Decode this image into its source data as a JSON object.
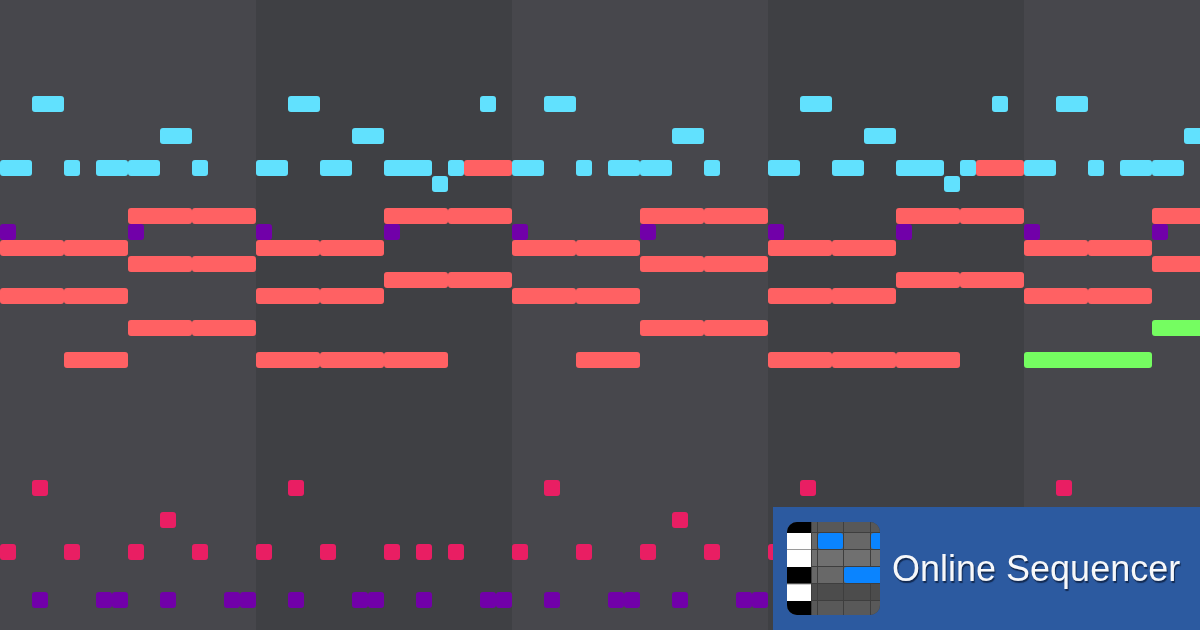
{
  "piano_roll": {
    "notes": [
      {
        "color": "#61e1fe"
      },
      {
        "color": "#61e1fe"
      },
      {
        "color": "#61e1fe"
      },
      {
        "color": "#61e1fe"
      },
      {
        "color": "#61e1fe"
      },
      {
        "color": "#61e1fe"
      },
      {
        "color": "#61e1fe"
      },
      {
        "color": "#61e1fe"
      },
      {
        "color": "#61e1fe"
      },
      {
        "color": "#61e1fe"
      },
      {
        "color": "#61e1fe"
      },
      {
        "color": "#61e1fe"
      },
      {
        "color": "#61e1fe"
      },
      {
        "color": "#61e1fe"
      },
      {
        "color": "#61e1fe"
      },
      {
        "color": "#61e1fe"
      },
      {
        "color": "#61e1fe"
      },
      {
        "color": "#61e1fe"
      },
      {
        "color": "#61e1fe"
      },
      {
        "color": "#61e1fe"
      },
      {
        "color": "#61e1fe"
      },
      {
        "color": "#ff6163"
      },
      {
        "color": "#61e1fe"
      },
      {
        "color": "#61e1fe"
      },
      {
        "color": "#61e1fe"
      },
      {
        "color": "#61e1fe"
      },
      {
        "color": "#61e1fe"
      },
      {
        "color": "#61e1fe"
      },
      {
        "color": "#61e1fe"
      },
      {
        "color": "#61e1fe"
      },
      {
        "color": "#61e1fe"
      },
      {
        "color": "#ff6163"
      },
      {
        "color": "#61e1fe"
      },
      {
        "color": "#61e1fe"
      },
      {
        "color": "#61e1fe"
      },
      {
        "color": "#61e1fe"
      },
      {
        "color": "#61e1fe"
      },
      {
        "color": "#61e1fe"
      },
      {
        "color": "#ff6163"
      },
      {
        "color": "#ff6163"
      },
      {
        "color": "#ff6163"
      },
      {
        "color": "#ff6163"
      },
      {
        "color": "#ff6163"
      },
      {
        "color": "#ff6163"
      },
      {
        "color": "#ff6163"
      },
      {
        "color": "#ff6163"
      },
      {
        "color": "#ff6163"
      },
      {
        "color": "#7100a9"
      },
      {
        "color": "#7100a9"
      },
      {
        "color": "#7100a9"
      },
      {
        "color": "#7100a9"
      },
      {
        "color": "#7100a9"
      },
      {
        "color": "#7100a9"
      },
      {
        "color": "#7100a9"
      },
      {
        "color": "#7100a9"
      },
      {
        "color": "#7100a9"
      },
      {
        "color": "#7100a9"
      },
      {
        "color": "#ff6163"
      },
      {
        "color": "#ff6163"
      },
      {
        "color": "#ff6163"
      },
      {
        "color": "#ff6163"
      },
      {
        "color": "#ff6163"
      },
      {
        "color": "#ff6163"
      },
      {
        "color": "#ff6163"
      },
      {
        "color": "#ff6163"
      },
      {
        "color": "#ff6163"
      },
      {
        "color": "#ff6163"
      },
      {
        "color": "#ff6163"
      },
      {
        "color": "#ff6163"
      },
      {
        "color": "#ff6163"
      },
      {
        "color": "#ff6163"
      },
      {
        "color": "#ff6163"
      },
      {
        "color": "#ff6163"
      },
      {
        "color": "#ff6163"
      },
      {
        "color": "#ff6163"
      },
      {
        "color": "#ff6163"
      },
      {
        "color": "#ff6163"
      },
      {
        "color": "#ff6163"
      },
      {
        "color": "#ff6163"
      },
      {
        "color": "#ff6163"
      },
      {
        "color": "#ff6163"
      },
      {
        "color": "#ff6163"
      },
      {
        "color": "#ff6163"
      },
      {
        "color": "#ff6163"
      },
      {
        "color": "#ff6163"
      },
      {
        "color": "#ff6163"
      },
      {
        "color": "#ff6163"
      },
      {
        "color": "#ff6163"
      },
      {
        "color": "#ff6163"
      },
      {
        "color": "#ff6163"
      },
      {
        "color": "#75fd61"
      },
      {
        "color": "#ff6163"
      },
      {
        "color": "#ff6163"
      },
      {
        "color": "#ff6163"
      },
      {
        "color": "#ff6163"
      },
      {
        "color": "#ff6163"
      },
      {
        "color": "#ff6163"
      },
      {
        "color": "#ff6163"
      },
      {
        "color": "#ff6163"
      },
      {
        "color": "#75fd61"
      },
      {
        "color": "#e91e63"
      },
      {
        "color": "#e91e63"
      },
      {
        "color": "#e91e63"
      },
      {
        "color": "#e91e63"
      },
      {
        "color": "#e91e63"
      },
      {
        "color": "#e91e63"
      },
      {
        "color": "#e91e63"
      },
      {
        "color": "#e91e63"
      },
      {
        "color": "#e91e63"
      },
      {
        "color": "#e91e63"
      },
      {
        "color": "#e91e63"
      },
      {
        "color": "#e91e63"
      },
      {
        "color": "#e91e63"
      },
      {
        "color": "#e91e63"
      },
      {
        "color": "#e91e63"
      },
      {
        "color": "#e91e63"
      },
      {
        "color": "#e91e63"
      },
      {
        "color": "#e91e63"
      },
      {
        "color": "#e91e63"
      },
      {
        "color": "#e91e63"
      },
      {
        "color": "#e91e63"
      },
      {
        "color": "#7100a9"
      },
      {
        "color": "#7100a9"
      },
      {
        "color": "#7100a9"
      },
      {
        "color": "#7100a9"
      },
      {
        "color": "#7100a9"
      },
      {
        "color": "#7100a9"
      },
      {
        "color": "#7100a9"
      },
      {
        "color": "#7100a9"
      },
      {
        "color": "#7100a9"
      },
      {
        "color": "#7100a9"
      },
      {
        "color": "#7100a9"
      },
      {
        "color": "#7100a9"
      },
      {
        "color": "#7100a9"
      },
      {
        "color": "#7100a9"
      },
      {
        "color": "#7100a9"
      },
      {
        "color": "#7100a9"
      },
      {
        "color": "#7100a9"
      },
      {
        "color": "#7100a9"
      }
    ]
  },
  "banner": {
    "title": "Online Sequencer"
  }
}
